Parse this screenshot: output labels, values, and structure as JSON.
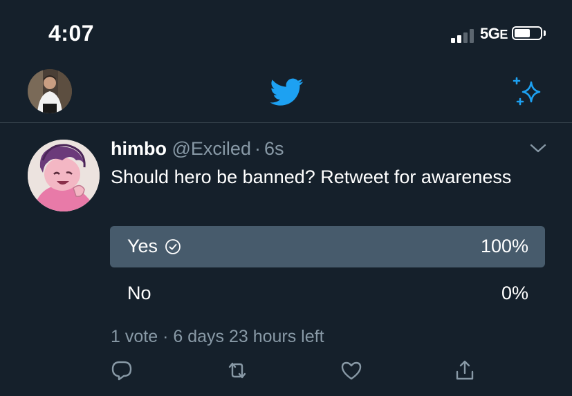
{
  "status_bar": {
    "time": "4:07",
    "network": "5G",
    "network_suffix": "E"
  },
  "nav": {
    "logo_icon": "twitter-bird-icon",
    "sparkle_icon": "sparkle-icon",
    "accent_color": "#1da1f2"
  },
  "tweet": {
    "author_name": "himbo",
    "handle": "@Exciled",
    "separator": "·",
    "time": "6s",
    "text": "Should hero be banned? Retweet for awareness",
    "poll": {
      "options": [
        {
          "label": "Yes",
          "percent": "100%",
          "selected": true
        },
        {
          "label": "No",
          "percent": "0%",
          "selected": false
        }
      ],
      "votes": "1 vote",
      "separator": "·",
      "time_left": "6 days 23 hours left"
    },
    "actions": [
      "reply-icon",
      "retweet-icon",
      "like-icon",
      "share-icon"
    ]
  }
}
